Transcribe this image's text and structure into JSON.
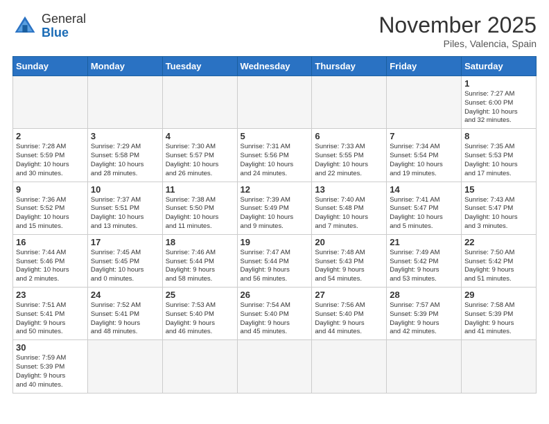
{
  "header": {
    "logo_general": "General",
    "logo_blue": "Blue",
    "month_title": "November 2025",
    "subtitle": "Piles, Valencia, Spain"
  },
  "days_of_week": [
    "Sunday",
    "Monday",
    "Tuesday",
    "Wednesday",
    "Thursday",
    "Friday",
    "Saturday"
  ],
  "weeks": [
    [
      {
        "day": "",
        "info": ""
      },
      {
        "day": "",
        "info": ""
      },
      {
        "day": "",
        "info": ""
      },
      {
        "day": "",
        "info": ""
      },
      {
        "day": "",
        "info": ""
      },
      {
        "day": "",
        "info": ""
      },
      {
        "day": "1",
        "info": "Sunrise: 7:27 AM\nSunset: 6:00 PM\nDaylight: 10 hours\nand 32 minutes."
      }
    ],
    [
      {
        "day": "2",
        "info": "Sunrise: 7:28 AM\nSunset: 5:59 PM\nDaylight: 10 hours\nand 30 minutes."
      },
      {
        "day": "3",
        "info": "Sunrise: 7:29 AM\nSunset: 5:58 PM\nDaylight: 10 hours\nand 28 minutes."
      },
      {
        "day": "4",
        "info": "Sunrise: 7:30 AM\nSunset: 5:57 PM\nDaylight: 10 hours\nand 26 minutes."
      },
      {
        "day": "5",
        "info": "Sunrise: 7:31 AM\nSunset: 5:56 PM\nDaylight: 10 hours\nand 24 minutes."
      },
      {
        "day": "6",
        "info": "Sunrise: 7:33 AM\nSunset: 5:55 PM\nDaylight: 10 hours\nand 22 minutes."
      },
      {
        "day": "7",
        "info": "Sunrise: 7:34 AM\nSunset: 5:54 PM\nDaylight: 10 hours\nand 19 minutes."
      },
      {
        "day": "8",
        "info": "Sunrise: 7:35 AM\nSunset: 5:53 PM\nDaylight: 10 hours\nand 17 minutes."
      }
    ],
    [
      {
        "day": "9",
        "info": "Sunrise: 7:36 AM\nSunset: 5:52 PM\nDaylight: 10 hours\nand 15 minutes."
      },
      {
        "day": "10",
        "info": "Sunrise: 7:37 AM\nSunset: 5:51 PM\nDaylight: 10 hours\nand 13 minutes."
      },
      {
        "day": "11",
        "info": "Sunrise: 7:38 AM\nSunset: 5:50 PM\nDaylight: 10 hours\nand 11 minutes."
      },
      {
        "day": "12",
        "info": "Sunrise: 7:39 AM\nSunset: 5:49 PM\nDaylight: 10 hours\nand 9 minutes."
      },
      {
        "day": "13",
        "info": "Sunrise: 7:40 AM\nSunset: 5:48 PM\nDaylight: 10 hours\nand 7 minutes."
      },
      {
        "day": "14",
        "info": "Sunrise: 7:41 AM\nSunset: 5:47 PM\nDaylight: 10 hours\nand 5 minutes."
      },
      {
        "day": "15",
        "info": "Sunrise: 7:43 AM\nSunset: 5:47 PM\nDaylight: 10 hours\nand 3 minutes."
      }
    ],
    [
      {
        "day": "16",
        "info": "Sunrise: 7:44 AM\nSunset: 5:46 PM\nDaylight: 10 hours\nand 2 minutes."
      },
      {
        "day": "17",
        "info": "Sunrise: 7:45 AM\nSunset: 5:45 PM\nDaylight: 10 hours\nand 0 minutes."
      },
      {
        "day": "18",
        "info": "Sunrise: 7:46 AM\nSunset: 5:44 PM\nDaylight: 9 hours\nand 58 minutes."
      },
      {
        "day": "19",
        "info": "Sunrise: 7:47 AM\nSunset: 5:44 PM\nDaylight: 9 hours\nand 56 minutes."
      },
      {
        "day": "20",
        "info": "Sunrise: 7:48 AM\nSunset: 5:43 PM\nDaylight: 9 hours\nand 54 minutes."
      },
      {
        "day": "21",
        "info": "Sunrise: 7:49 AM\nSunset: 5:42 PM\nDaylight: 9 hours\nand 53 minutes."
      },
      {
        "day": "22",
        "info": "Sunrise: 7:50 AM\nSunset: 5:42 PM\nDaylight: 9 hours\nand 51 minutes."
      }
    ],
    [
      {
        "day": "23",
        "info": "Sunrise: 7:51 AM\nSunset: 5:41 PM\nDaylight: 9 hours\nand 50 minutes."
      },
      {
        "day": "24",
        "info": "Sunrise: 7:52 AM\nSunset: 5:41 PM\nDaylight: 9 hours\nand 48 minutes."
      },
      {
        "day": "25",
        "info": "Sunrise: 7:53 AM\nSunset: 5:40 PM\nDaylight: 9 hours\nand 46 minutes."
      },
      {
        "day": "26",
        "info": "Sunrise: 7:54 AM\nSunset: 5:40 PM\nDaylight: 9 hours\nand 45 minutes."
      },
      {
        "day": "27",
        "info": "Sunrise: 7:56 AM\nSunset: 5:40 PM\nDaylight: 9 hours\nand 44 minutes."
      },
      {
        "day": "28",
        "info": "Sunrise: 7:57 AM\nSunset: 5:39 PM\nDaylight: 9 hours\nand 42 minutes."
      },
      {
        "day": "29",
        "info": "Sunrise: 7:58 AM\nSunset: 5:39 PM\nDaylight: 9 hours\nand 41 minutes."
      }
    ],
    [
      {
        "day": "30",
        "info": "Sunrise: 7:59 AM\nSunset: 5:39 PM\nDaylight: 9 hours\nand 40 minutes."
      },
      {
        "day": "",
        "info": ""
      },
      {
        "day": "",
        "info": ""
      },
      {
        "day": "",
        "info": ""
      },
      {
        "day": "",
        "info": ""
      },
      {
        "day": "",
        "info": ""
      },
      {
        "day": "",
        "info": ""
      }
    ]
  ]
}
